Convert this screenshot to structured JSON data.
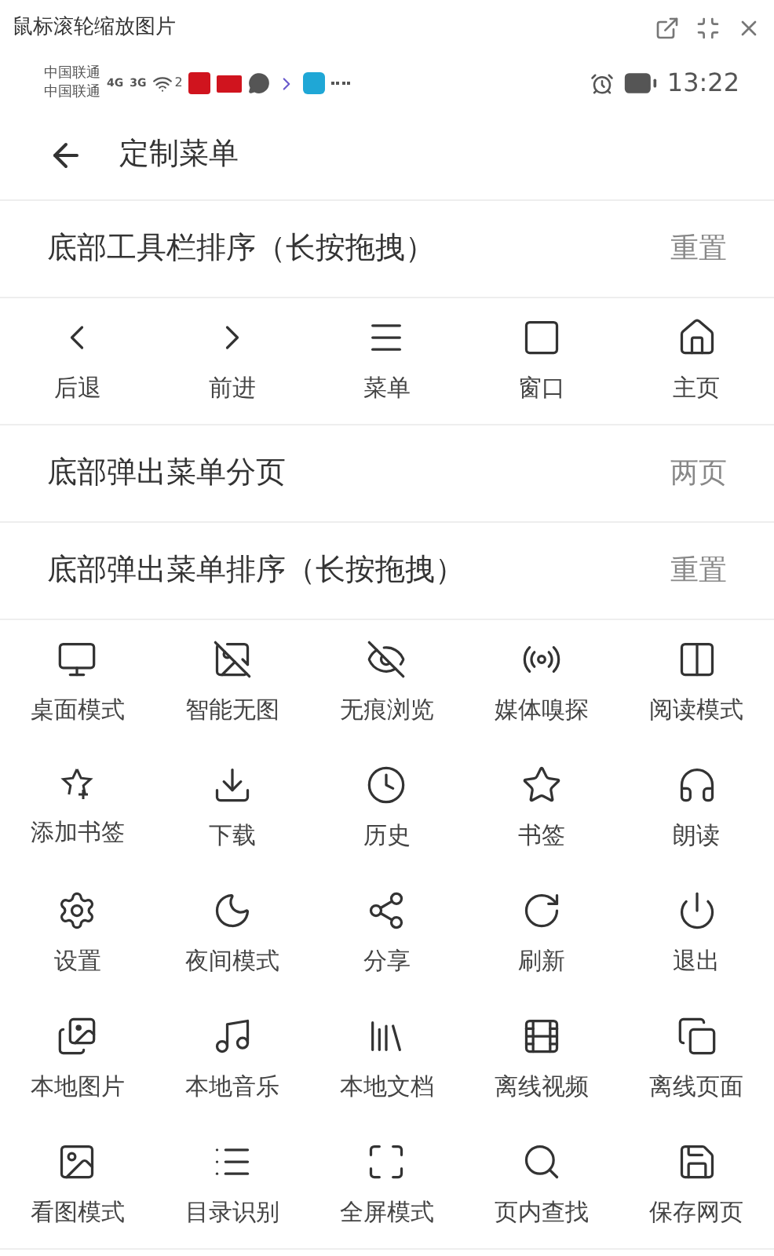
{
  "window": {
    "title": "鼠标滚轮缩放图片"
  },
  "status_bar": {
    "carriers": [
      "中国联通",
      "中国联通"
    ],
    "networks": [
      "4G",
      "3G"
    ],
    "hotspot_count": "2",
    "time": "13:22"
  },
  "header": {
    "title": "定制菜单"
  },
  "sections": [
    {
      "kind": "heading",
      "label": "底部工具栏排序（长按拖拽）",
      "action": "重置"
    },
    {
      "kind": "grid",
      "items": [
        "后退",
        "前进",
        "菜单",
        "窗口",
        "主页"
      ]
    },
    {
      "kind": "heading",
      "label": "底部弹出菜单分页",
      "action": "两页"
    },
    {
      "kind": "heading",
      "label": "底部弹出菜单排序（长按拖拽）",
      "action": "重置"
    },
    {
      "kind": "grid",
      "items": [
        "桌面模式",
        "智能无图",
        "无痕浏览",
        "媒体嗅探",
        "阅读模式",
        "添加书签",
        "下载",
        "历史",
        "书签",
        "朗读",
        "设置",
        "夜间模式",
        "分享",
        "刷新",
        "退出",
        "本地图片",
        "本地音乐",
        "本地文档",
        "离线视频",
        "离线页面",
        "看图模式",
        "目录识别",
        "全屏模式",
        "页内查找",
        "保存网页"
      ]
    }
  ]
}
